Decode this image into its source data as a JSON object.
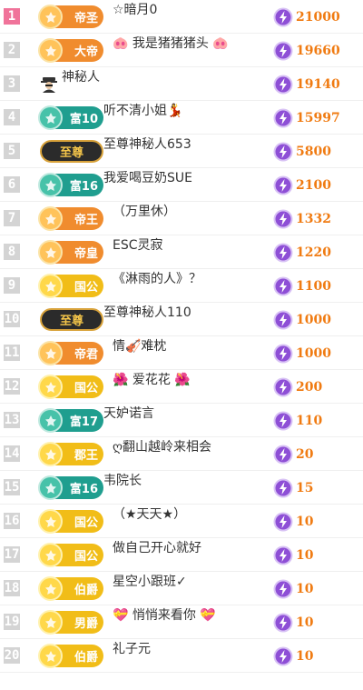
{
  "rows": [
    {
      "rank": "1",
      "title": "帝圣",
      "style": "orange",
      "name": "☆暗月0",
      "amount": "21000"
    },
    {
      "rank": "2",
      "title": "大帝",
      "style": "orange",
      "name": "🐽 我是猪猪猪头 🐽",
      "amount": "19660"
    },
    {
      "rank": "3",
      "title": "",
      "style": "spy",
      "name": "神秘人",
      "amount": "19140"
    },
    {
      "rank": "4",
      "title": "富10",
      "style": "teal",
      "name": "听不清小姐💃",
      "amount": "15997"
    },
    {
      "rank": "5",
      "title": "至尊",
      "style": "dark",
      "name": "至尊神秘人653",
      "amount": "5800"
    },
    {
      "rank": "6",
      "title": "富16",
      "style": "teal",
      "name": "我爱喝豆奶SUE",
      "amount": "2100"
    },
    {
      "rank": "7",
      "title": "帝王",
      "style": "orange",
      "name": "（万里休）",
      "amount": "1332"
    },
    {
      "rank": "8",
      "title": "帝皇",
      "style": "orange",
      "name": "ESC灵寂",
      "amount": "1220"
    },
    {
      "rank": "9",
      "title": "国公",
      "style": "gold",
      "name": "《淋雨的人》？",
      "amount": "1100"
    },
    {
      "rank": "10",
      "title": "至尊",
      "style": "dark",
      "name": "至尊神秘人110",
      "amount": "1000"
    },
    {
      "rank": "11",
      "title": "帝君",
      "style": "orange",
      "name": "情🎻难枕",
      "amount": "1000"
    },
    {
      "rank": "12",
      "title": "国公",
      "style": "gold",
      "name": "🌺 爱花花 🌺",
      "amount": "200"
    },
    {
      "rank": "13",
      "title": "富17",
      "style": "teal",
      "name": "天妒诺言",
      "amount": "110"
    },
    {
      "rank": "14",
      "title": "郡王",
      "style": "gold",
      "name": "ღ翻山越岭来相会",
      "amount": "20"
    },
    {
      "rank": "15",
      "title": "富16",
      "style": "teal",
      "name": "韦院长",
      "amount": "15"
    },
    {
      "rank": "16",
      "title": "国公",
      "style": "gold",
      "name": "（★天天★）",
      "amount": "10"
    },
    {
      "rank": "17",
      "title": "国公",
      "style": "gold",
      "name": "做自己开心就好",
      "amount": "10"
    },
    {
      "rank": "18",
      "title": "伯爵",
      "style": "gold",
      "name": "星空小跟班✓",
      "amount": "10"
    },
    {
      "rank": "19",
      "title": "男爵",
      "style": "gold",
      "name": "💝 悄悄来看你 💝",
      "amount": "10"
    },
    {
      "rank": "20",
      "title": "伯爵",
      "style": "gold",
      "name": "礼子元",
      "amount": "10"
    }
  ],
  "icons": {
    "currency": "lightning-coin-icon",
    "level": "level-emblem-icon",
    "anonymous": "anonymous-spy-icon"
  },
  "colors": {
    "amount": "#f07b12",
    "rank_top": "#f0739a",
    "rank_default": "#d4d4d4",
    "coin": "#8e4fd6"
  }
}
